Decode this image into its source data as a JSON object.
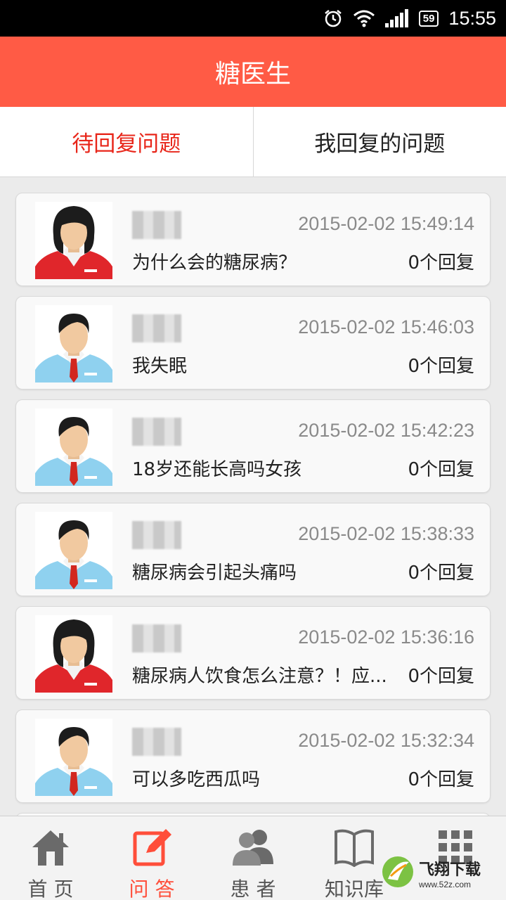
{
  "status_bar": {
    "battery": "59",
    "time": "15:55",
    "icons": [
      "alarm-icon",
      "wifi-icon",
      "signal-icon",
      "battery-icon"
    ]
  },
  "header": {
    "title": "糖医生"
  },
  "tabs": [
    {
      "label": "待回复问题",
      "active": true
    },
    {
      "label": "我回复的问题",
      "active": false
    }
  ],
  "questions": [
    {
      "avatar": "female",
      "time": "2015-02-02 15:49:14",
      "text": "为什么会的糖尿病？",
      "replies": "0个回复"
    },
    {
      "avatar": "male",
      "time": "2015-02-02 15:46:03",
      "text": "我失眠",
      "replies": "0个回复"
    },
    {
      "avatar": "male",
      "time": "2015-02-02 15:42:23",
      "text": "18岁还能长高吗女孩",
      "replies": "0个回复"
    },
    {
      "avatar": "male",
      "time": "2015-02-02 15:38:33",
      "text": "糖尿病会引起头痛吗",
      "replies": "0个回复"
    },
    {
      "avatar": "female",
      "time": "2015-02-02 15:36:16",
      "text": "糖尿病人饮食怎么注意？！应...",
      "replies": "0个回复"
    },
    {
      "avatar": "male",
      "time": "2015-02-02 15:32:34",
      "text": "可以多吃西瓜吗",
      "replies": "0个回复"
    }
  ],
  "bottom_nav": [
    {
      "label": "首 页",
      "icon": "home-icon",
      "active": false
    },
    {
      "label": "问 答",
      "icon": "edit-icon",
      "active": true
    },
    {
      "label": "患 者",
      "icon": "patients-icon",
      "active": false
    },
    {
      "label": "知识库",
      "icon": "book-icon",
      "active": false
    },
    {
      "label": "",
      "icon": "grid-icon",
      "active": false
    }
  ],
  "watermark": {
    "text": "飞翔下载",
    "sub": "www.52z.com"
  },
  "colors": {
    "header_bg": "#ff5b45",
    "active_tab": "#e8261a",
    "active_nav": "#ff4e3a"
  }
}
